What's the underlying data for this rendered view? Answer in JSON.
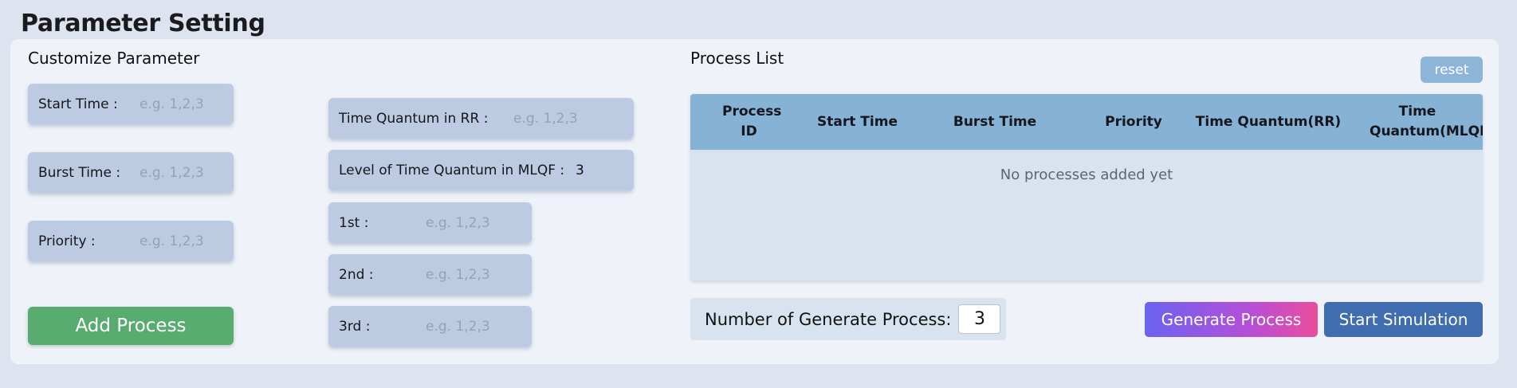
{
  "page_title": "Parameter Setting",
  "customize": {
    "title": "Customize Parameter",
    "start_time": {
      "label": "Start Time :",
      "placeholder": "e.g. 1,2,3"
    },
    "burst_time": {
      "label": "Burst Time :",
      "placeholder": "e.g. 1,2,3"
    },
    "priority": {
      "label": "Priority :",
      "placeholder": "e.g. 1,2,3"
    },
    "time_quantum_rr": {
      "label": "Time Quantum in RR :",
      "placeholder": "e.g. 1,2,3"
    },
    "mlqf_levels": {
      "label": "Level of Time Quantum in MLQF :",
      "value": "3"
    },
    "level_1": {
      "label": "1st :",
      "placeholder": "e.g. 1,2,3"
    },
    "level_2": {
      "label": "2nd :",
      "placeholder": "e.g. 1,2,3"
    },
    "level_3": {
      "label": "3rd :",
      "placeholder": "e.g. 1,2,3"
    },
    "add_button": "Add Process"
  },
  "process_list": {
    "title": "Process List",
    "reset_button": "reset",
    "columns": [
      "Process ID",
      "Start Time",
      "Burst Time",
      "Priority",
      "Time Quantum(RR)",
      "Time Quantum(MLQF)"
    ],
    "empty_message": "No processes added yet"
  },
  "generate": {
    "label": "Number of Generate Process:",
    "value": "3",
    "generate_button": "Generate Process",
    "simulate_button": "Start Simulation"
  },
  "colors": {
    "field_bg": "#bccbe2",
    "add_button": "#58ac70",
    "table_header": "#86b2d6",
    "simulate_button": "#3f6db0",
    "generate_gradient_start": "#6a63f0",
    "generate_gradient_end": "#ea4d9c"
  }
}
